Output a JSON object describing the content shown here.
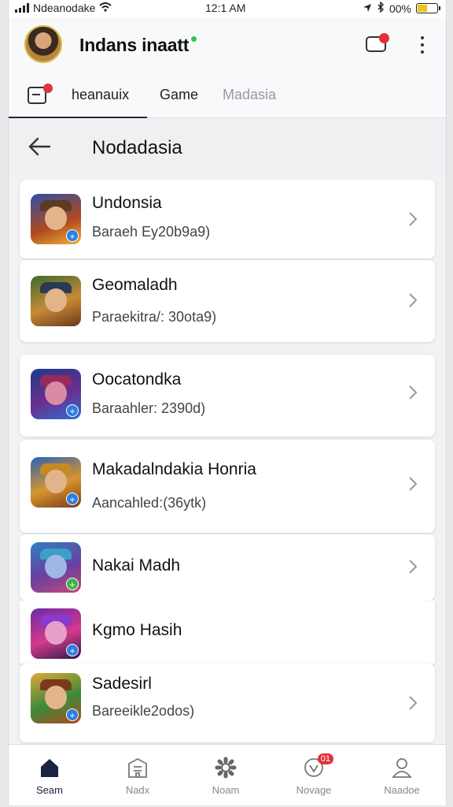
{
  "status_bar": {
    "carrier": "Ndeanodake",
    "time": "12:1 AM",
    "battery": "00%",
    "battery_level": 0.5
  },
  "header": {
    "title": "Indans inaatt",
    "tabs": [
      {
        "label": "heanauix",
        "active": true
      },
      {
        "label": "Game",
        "active": false
      },
      {
        "label": "Madasia",
        "active": false
      }
    ]
  },
  "sub_header": {
    "title": "Nodadasia"
  },
  "games": [
    {
      "name": "Undonsia",
      "subtitle": "Baraeh Ey20b9a9)"
    },
    {
      "name": "Geomaladh",
      "subtitle": "Paraekitra/: 30ota9)"
    },
    {
      "name": "Oocatondka",
      "subtitle": "Baraahler: 2390d)"
    },
    {
      "name": "Makadalndakia Honria",
      "subtitle": "Aancahled:(36ytk)"
    },
    {
      "name": "Nakai Madh",
      "subtitle": ""
    },
    {
      "name": "Kgmo Hasih",
      "subtitle": ""
    },
    {
      "name": "Sadesirl",
      "subtitle": "Bareeikle2odos)"
    }
  ],
  "bottom_nav": [
    {
      "label": "Seam",
      "icon": "home-icon",
      "active": true
    },
    {
      "label": "Nadx",
      "icon": "building-icon",
      "active": false
    },
    {
      "label": "Noam",
      "icon": "gear-icon",
      "active": false
    },
    {
      "label": "Novage",
      "icon": "heart-icon",
      "active": false,
      "badge": "01"
    },
    {
      "label": "Naadoe",
      "icon": "user-icon",
      "active": false
    }
  ],
  "colors": {
    "accent": "#1f2a3c",
    "badge": "#e2313a",
    "online": "#36c252",
    "battery": "#e8c51a"
  }
}
